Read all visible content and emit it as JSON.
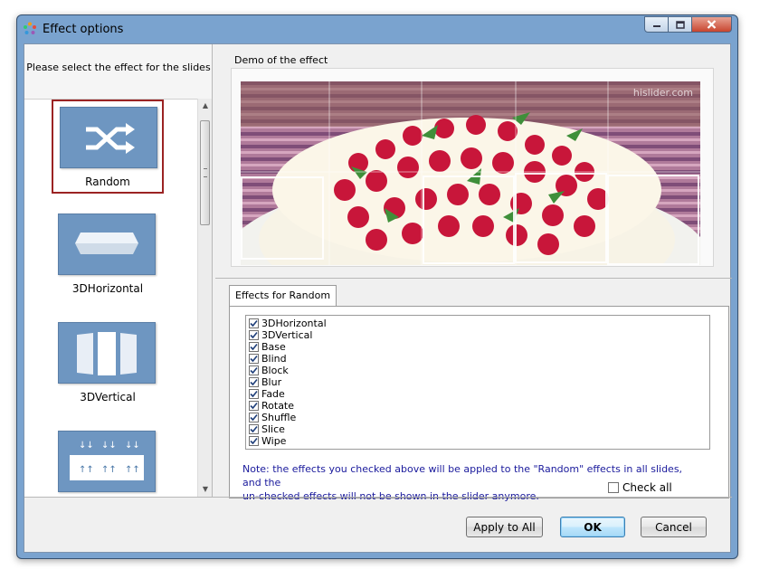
{
  "window": {
    "title": "Effect options"
  },
  "left_panel": {
    "prompt": "Please select the effect for the slides",
    "effects": [
      {
        "label": "Random",
        "icon": "shuffle-icon",
        "selected": true
      },
      {
        "label": "3DHorizontal",
        "icon": "3d-horizontal-icon",
        "selected": false
      },
      {
        "label": "3DVertical",
        "icon": "3d-vertical-icon",
        "selected": false
      },
      {
        "label": "",
        "icon": "blind-effect-icon",
        "selected": false
      }
    ]
  },
  "demo": {
    "label": "Demo of the effect",
    "watermark": "hislider.com",
    "image": "raspberry-cake-photo"
  },
  "effects_tab": {
    "label": "Effects for Random",
    "items": [
      {
        "label": "3DHorizontal",
        "checked": true
      },
      {
        "label": "3DVertical",
        "checked": true
      },
      {
        "label": "Base",
        "checked": true
      },
      {
        "label": "Blind",
        "checked": true
      },
      {
        "label": "Block",
        "checked": true
      },
      {
        "label": "Blur",
        "checked": true
      },
      {
        "label": "Fade",
        "checked": true
      },
      {
        "label": "Rotate",
        "checked": true
      },
      {
        "label": "Shuffle",
        "checked": true
      },
      {
        "label": "Slice",
        "checked": true
      },
      {
        "label": "Wipe",
        "checked": true
      }
    ],
    "note_line1": "Note: the effects you checked above will be appled to the \"Random\"  effects in all slides, and the",
    "note_line2": "un-checked effects will not be shown in the slider anymore.",
    "check_all_label": "Check all",
    "check_all_checked": false
  },
  "buttons": {
    "apply": "Apply to All",
    "ok": "OK",
    "cancel": "Cancel"
  },
  "colors": {
    "frame": "#7aa3cf",
    "thumbnail": "#6e96c1",
    "selection_border": "#9b2323",
    "note_text": "#1a1a9c"
  }
}
